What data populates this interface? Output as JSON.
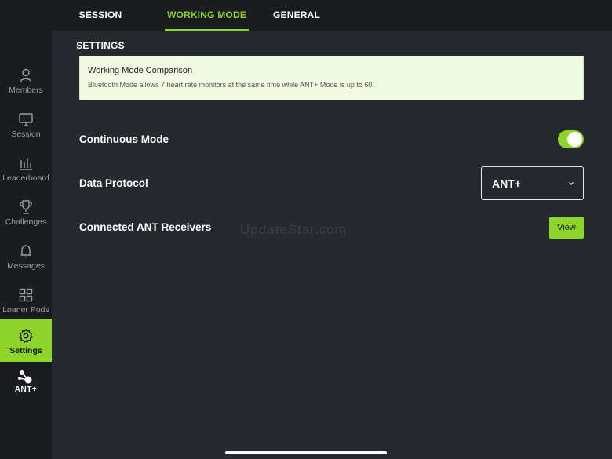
{
  "tabs": [
    {
      "label": "SESSION SETTINGS",
      "active": false
    },
    {
      "label": "WORKING MODE",
      "active": true
    },
    {
      "label": "GENERAL",
      "active": false
    }
  ],
  "sidebar": {
    "items": [
      {
        "label": "Members",
        "icon": "person-icon"
      },
      {
        "label": "Session",
        "icon": "monitor-icon"
      },
      {
        "label": "Leaderboard",
        "icon": "leaderboard-icon"
      },
      {
        "label": "Challenges",
        "icon": "trophy-icon"
      },
      {
        "label": "Messages",
        "icon": "bell-icon"
      },
      {
        "label": "Loaner Pods",
        "icon": "grid-icon"
      },
      {
        "label": "Settings",
        "icon": "gear-icon",
        "active": true
      }
    ],
    "ant_label": "ANT+"
  },
  "info": {
    "title": "Working Mode Comparison",
    "text": "Bluetooth Mode allows 7 heart rate monitors at the same time while ANT+ Mode is up to 60."
  },
  "settings": {
    "continuous_mode_label": "Continuous Mode",
    "continuous_mode_on": true,
    "data_protocol_label": "Data Protocol",
    "data_protocol_value": "ANT+",
    "receivers_label": "Connected ANT Receivers",
    "view_label": "View"
  },
  "watermark": "UpdateStar.com",
  "colors": {
    "accent": "#8fd42a",
    "background": "#26292e",
    "sidebar": "#1b1c1f"
  }
}
